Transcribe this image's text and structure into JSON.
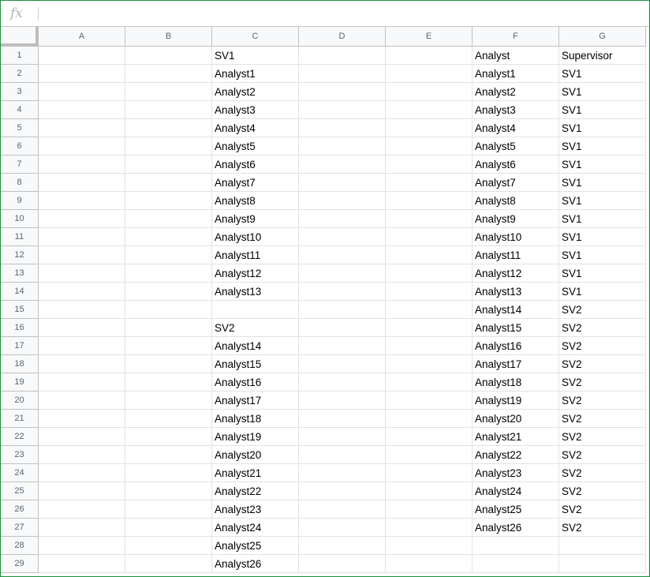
{
  "formula_bar": {
    "fx_label": "fx",
    "value": ""
  },
  "columns": [
    "A",
    "B",
    "C",
    "D",
    "E",
    "F",
    "G"
  ],
  "rows": [
    {
      "num": "1",
      "C": "SV1",
      "F": "Analyst",
      "G": "Supervisor"
    },
    {
      "num": "2",
      "C": "Analyst1",
      "F": "Analyst1",
      "G": "SV1"
    },
    {
      "num": "3",
      "C": "Analyst2",
      "F": "Analyst2",
      "G": "SV1"
    },
    {
      "num": "4",
      "C": "Analyst3",
      "F": "Analyst3",
      "G": "SV1"
    },
    {
      "num": "5",
      "C": "Analyst4",
      "F": "Analyst4",
      "G": "SV1"
    },
    {
      "num": "6",
      "C": "Analyst5",
      "F": "Analyst5",
      "G": "SV1"
    },
    {
      "num": "7",
      "C": "Analyst6",
      "F": "Analyst6",
      "G": "SV1"
    },
    {
      "num": "8",
      "C": "Analyst7",
      "F": "Analyst7",
      "G": "SV1"
    },
    {
      "num": "9",
      "C": "Analyst8",
      "F": "Analyst8",
      "G": "SV1"
    },
    {
      "num": "10",
      "C": "Analyst9",
      "F": "Analyst9",
      "G": "SV1"
    },
    {
      "num": "11",
      "C": "Analyst10",
      "F": "Analyst10",
      "G": "SV1"
    },
    {
      "num": "12",
      "C": "Analyst11",
      "F": "Analyst11",
      "G": "SV1"
    },
    {
      "num": "13",
      "C": "Analyst12",
      "F": "Analyst12",
      "G": "SV1"
    },
    {
      "num": "14",
      "C": "Analyst13",
      "F": "Analyst13",
      "G": "SV1"
    },
    {
      "num": "15",
      "C": "",
      "F": "Analyst14",
      "G": "SV2"
    },
    {
      "num": "16",
      "C": "SV2",
      "F": "Analyst15",
      "G": "SV2"
    },
    {
      "num": "17",
      "C": "Analyst14",
      "F": "Analyst16",
      "G": "SV2"
    },
    {
      "num": "18",
      "C": "Analyst15",
      "F": "Analyst17",
      "G": "SV2"
    },
    {
      "num": "19",
      "C": "Analyst16",
      "F": "Analyst18",
      "G": "SV2"
    },
    {
      "num": "20",
      "C": "Analyst17",
      "F": "Analyst19",
      "G": "SV2"
    },
    {
      "num": "21",
      "C": "Analyst18",
      "F": "Analyst20",
      "G": "SV2"
    },
    {
      "num": "22",
      "C": "Analyst19",
      "F": "Analyst21",
      "G": "SV2"
    },
    {
      "num": "23",
      "C": "Analyst20",
      "F": "Analyst22",
      "G": "SV2"
    },
    {
      "num": "24",
      "C": "Analyst21",
      "F": "Analyst23",
      "G": "SV2"
    },
    {
      "num": "25",
      "C": "Analyst22",
      "F": "Analyst24",
      "G": "SV2"
    },
    {
      "num": "26",
      "C": "Analyst23",
      "F": "Analyst25",
      "G": "SV2"
    },
    {
      "num": "27",
      "C": "Analyst24",
      "F": "Analyst26",
      "G": "SV2"
    },
    {
      "num": "28",
      "C": "Analyst25",
      "F": "",
      "G": ""
    },
    {
      "num": "29",
      "C": "Analyst26",
      "F": "",
      "G": ""
    }
  ]
}
